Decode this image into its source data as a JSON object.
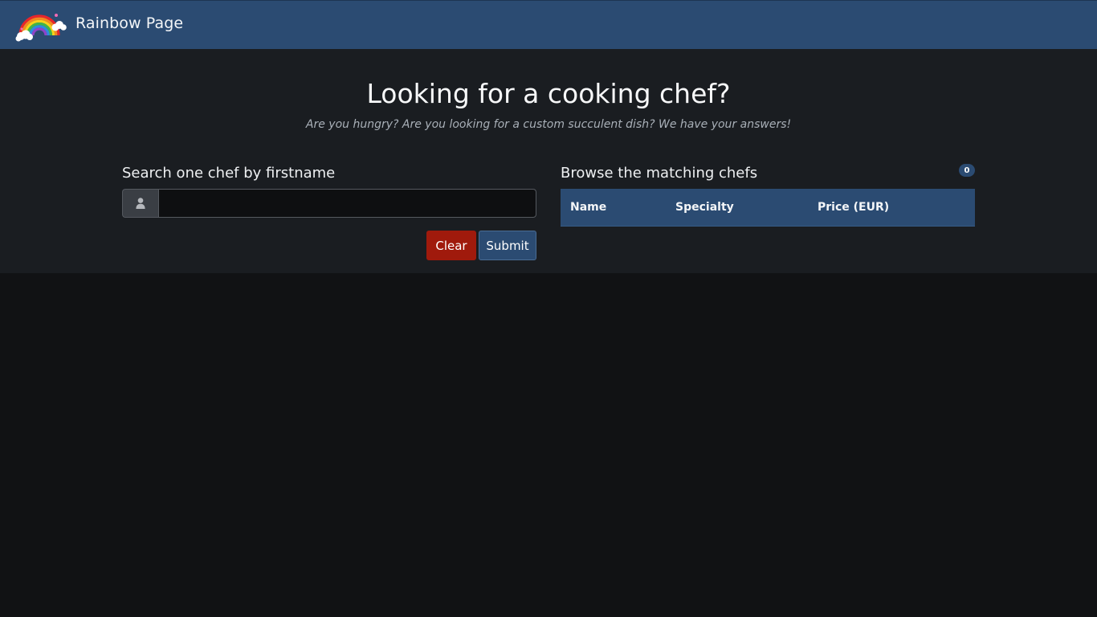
{
  "header": {
    "brand_title": "Rainbow Page",
    "logo_icon": "rainbow-icon"
  },
  "hero": {
    "title": "Looking for a cooking chef?",
    "subtitle": "Are you hungry? Are you looking for a custom succulent dish? We have your answers!"
  },
  "search": {
    "heading": "Search one chef by firstname",
    "input_value": "",
    "placeholder": "",
    "user_icon": "user-icon",
    "clear_label": "Clear",
    "submit_label": "Submit"
  },
  "results": {
    "heading": "Browse the matching chefs",
    "count": "0",
    "columns": [
      "Name",
      "Specialty",
      "Price (EUR)"
    ],
    "rows": []
  },
  "colors": {
    "navbar": "#2b4b72",
    "hero_background": "#1a1d21",
    "page_background": "#111214",
    "clear_button": "#a01a0c",
    "submit_button": "#2b4b72"
  }
}
